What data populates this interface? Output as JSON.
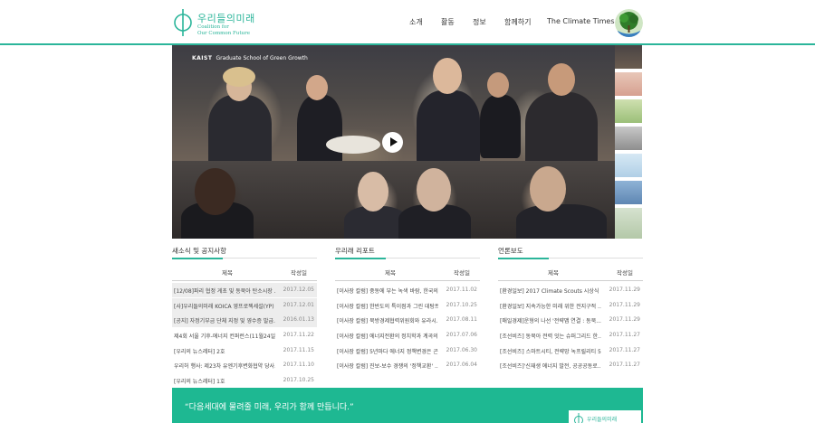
{
  "brand": {
    "name_kr": "우리들의미래",
    "name_en_line1": "Coalition for",
    "name_en_line2": "Our Common Future"
  },
  "nav": {
    "items": [
      "소개",
      "활동",
      "정보",
      "함께하기",
      "The Climate Times"
    ]
  },
  "hero": {
    "caption_org": "KAIST",
    "caption_text": "Graduate School of Green Growth"
  },
  "columns": [
    {
      "title": "새소식 및 공지사항",
      "head_title": "제목",
      "head_date": "작성일",
      "rows": [
        {
          "title": "[12/08]파리 협정 게초 및 동북아 탄소시장 ...",
          "date": "2017.12.05",
          "shaded": true
        },
        {
          "title": "[사]우리들의미래 KOICA 영프로젝세설(YP) ...",
          "date": "2017.12.01",
          "shaded": true
        },
        {
          "title": "[공지] 자정기부금 단체 지정 및 영수증 발급...",
          "date": "2016.01.13",
          "shaded": true
        },
        {
          "title": "제4회 서울 기후-에너지 컨퍼런스(11월24일) ...",
          "date": "2017.11.22",
          "shaded": false
        },
        {
          "title": "[우리의 뉴스레터] 2호",
          "date": "2017.11.15",
          "shaded": false
        },
        {
          "title": "우리허 행사: 제23차 유엔기후변화협약 당사...",
          "date": "2017.11.10",
          "shaded": false
        },
        {
          "title": "[우리의 뉴스레터] 1호",
          "date": "2017.10.25",
          "shaded": false
        }
      ]
    },
    {
      "title": "우리래 리포트",
      "head_title": "제목",
      "head_date": "작성일",
      "rows": [
        {
          "title": "[이사장 칼럼] 중동에 부는 녹색 바람, 한국의 ...",
          "date": "2017.11.02",
          "shaded": false
        },
        {
          "title": "[이사장 칼럼] 한반도의 특이점과 그린 데탕트 ...",
          "date": "2017.10.25",
          "shaded": false
        },
        {
          "title": "[이사장 칼럼] 북방경제협력위원회와 유라시...",
          "date": "2017.08.11",
          "shaded": false
        },
        {
          "title": "[이사장 칼럼] 에너지전환의 정치학과 계곡의...",
          "date": "2017.07.06",
          "shaded": false
        },
        {
          "title": "[이사장 칼럼] 5년마다 에너지 정책변경은 곤...",
          "date": "2017.06.30",
          "shaded": false
        },
        {
          "title": "[이사장 칼럼] 진보-보수 경쟁의 '정책교환' ...",
          "date": "2017.06.04",
          "shaded": false
        }
      ]
    },
    {
      "title": "언론보도",
      "head_title": "제목",
      "head_date": "작성일",
      "rows": [
        {
          "title": "[환경일보] 2017 Climate Scouts 시상식",
          "date": "2017.11.29",
          "shaded": false
        },
        {
          "title": "[환경일보] 지속가능한 미래 위한 전지구적 ...",
          "date": "2017.11.29",
          "shaded": false
        },
        {
          "title": "[매일경제]운형의 나선 '전략맵 연결 : 동북...",
          "date": "2017.11.29",
          "shaded": false
        },
        {
          "title": "[조선비즈] 동북아 전력 잇는 슈퍼그리드 한...",
          "date": "2017.11.27",
          "shaded": false
        },
        {
          "title": "[조선비즈] 스마트시티, 전략망 녹프릴리티 5...",
          "date": "2017.11.27",
          "shaded": false
        },
        {
          "title": "[조선비즈]'신재생 에너지 발전, 공공공동로...",
          "date": "2017.11.27",
          "shaded": false
        }
      ]
    }
  ],
  "banner": {
    "slogan": "“다음세대에 물려줄 미래, 우리가 함께 만듭니다.”",
    "logo_text": "우리들의미래"
  },
  "colors": {
    "accent": "#2bb59a",
    "banner": "#1eb892"
  }
}
